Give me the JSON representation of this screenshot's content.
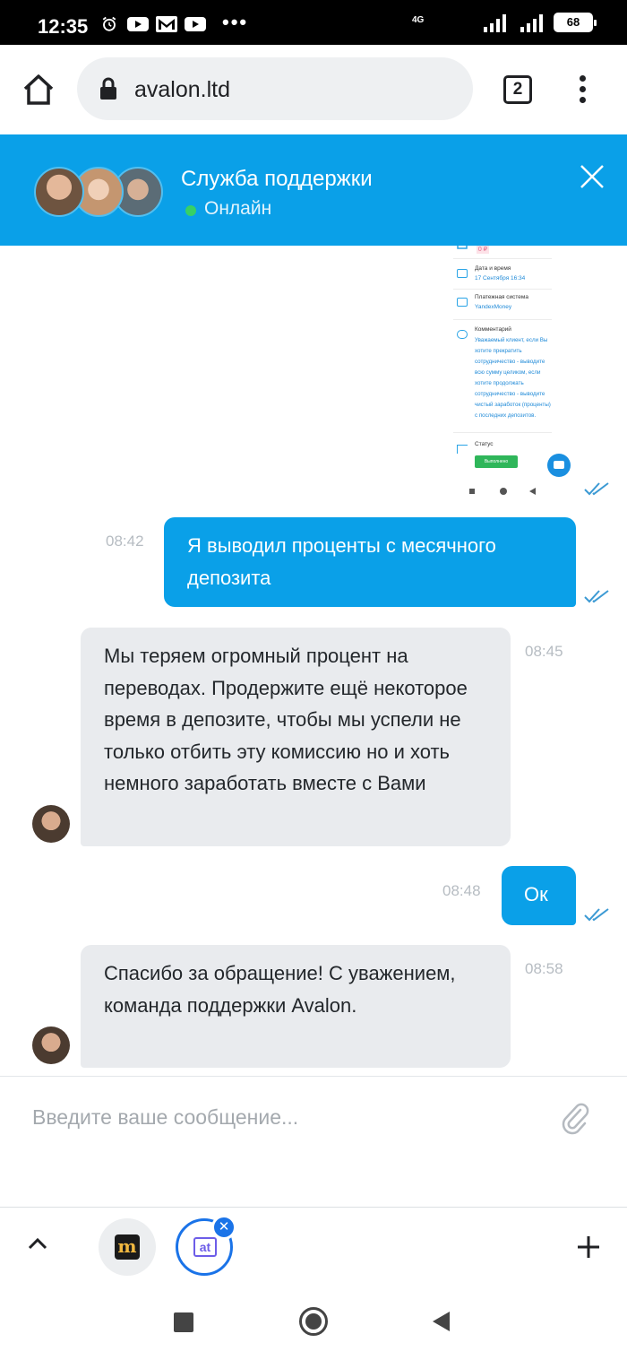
{
  "status_bar": {
    "time": "12:35",
    "network": "4G",
    "battery": "68",
    "more": "•••"
  },
  "browser": {
    "url": "avalon.ltd",
    "tab_count": "2"
  },
  "chat_header": {
    "title": "Служба поддержки",
    "status": "Онлайн"
  },
  "shared_image": {
    "amount": "0 ₽",
    "rows": [
      {
        "label": "Дата и время",
        "value": "17 Сентября 16:34"
      },
      {
        "label": "Платежная система",
        "value": "YandexMoney"
      },
      {
        "label": "Комментарий",
        "value": "Уважаемый клиент, если Вы хотите прекратить сотрудничество - выводите всю сумму целиком, если хотите продолжать сотрудничество - выводите чистый заработок (проценты) с последних депозитов."
      },
      {
        "label": "Статус",
        "value": ""
      }
    ],
    "button_label": "Выполнено"
  },
  "messages": [
    {
      "direction": "out",
      "time": "08:42",
      "text": "Я выводил проценты с месячного депозита"
    },
    {
      "direction": "in",
      "time": "08:45",
      "text": "Мы теряем огромный процент на переводах. Продержите ещё некоторое время в депозите, чтобы мы успели не только отбить эту комиссию но и хоть немного заработать вместе с Вами"
    },
    {
      "direction": "out",
      "time": "08:48",
      "text": "Ок"
    },
    {
      "direction": "in",
      "time": "08:58",
      "text": "Спасибо за обращение! С уважением, команда поддержки Avalon."
    }
  ],
  "input": {
    "placeholder": "Введите ваше сообщение..."
  },
  "toolbar": {
    "app1_letter": "m",
    "app2_label": "at",
    "close_badge": "✕"
  },
  "colors": {
    "accent": "#0aa0e8",
    "online": "#37d066",
    "incoming_bubble": "#e9ebee"
  }
}
